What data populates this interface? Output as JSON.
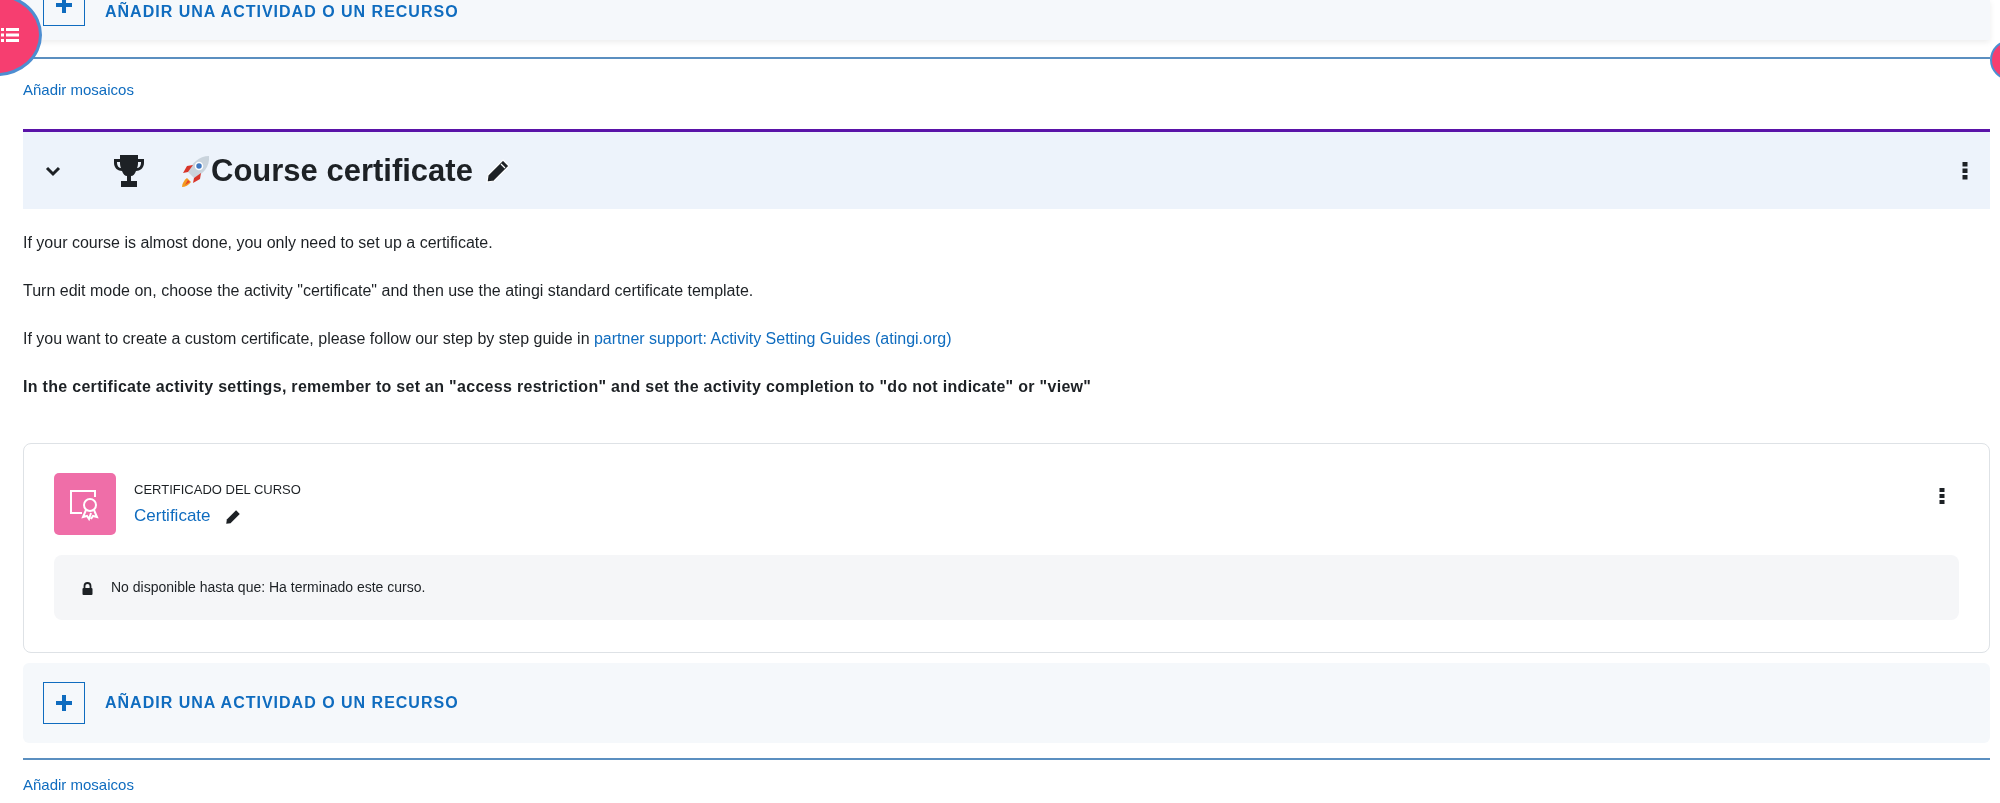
{
  "top_add_bar": {
    "label": "AÑADIR UNA ACTIVIDAD O UN RECURSO"
  },
  "top_add_tiles": "Añadir mosaicos",
  "section": {
    "expanded": true,
    "title": "Course certificate",
    "summary": [
      {
        "kind": "text",
        "text": "If your course is almost done, you only need to set up a certificate."
      },
      {
        "kind": "text",
        "text": "Turn edit mode on, choose the activity \"certificate\" and then use the atingi standard certificate template."
      },
      {
        "kind": "link",
        "text": "If you want to create a custom certificate, please follow our step by step guide in ",
        "link": "partner support: Activity Setting Guides (atingi.org)"
      },
      {
        "kind": "bold",
        "text": "In the certificate activity settings, remember to set an \"access restriction\" and set the activity completion to \"do not indicate\" or \"view\""
      }
    ],
    "activities": [
      {
        "type_label": "CERTIFICADO DEL CURSO",
        "name": "Certificate",
        "restriction": "No disponible hasta que: Ha terminado este curso."
      }
    ],
    "add_bar": {
      "label": "AÑADIR UNA ACTIVIDAD O UN RECURSO"
    },
    "add_tiles": "Añadir mosaicos"
  }
}
